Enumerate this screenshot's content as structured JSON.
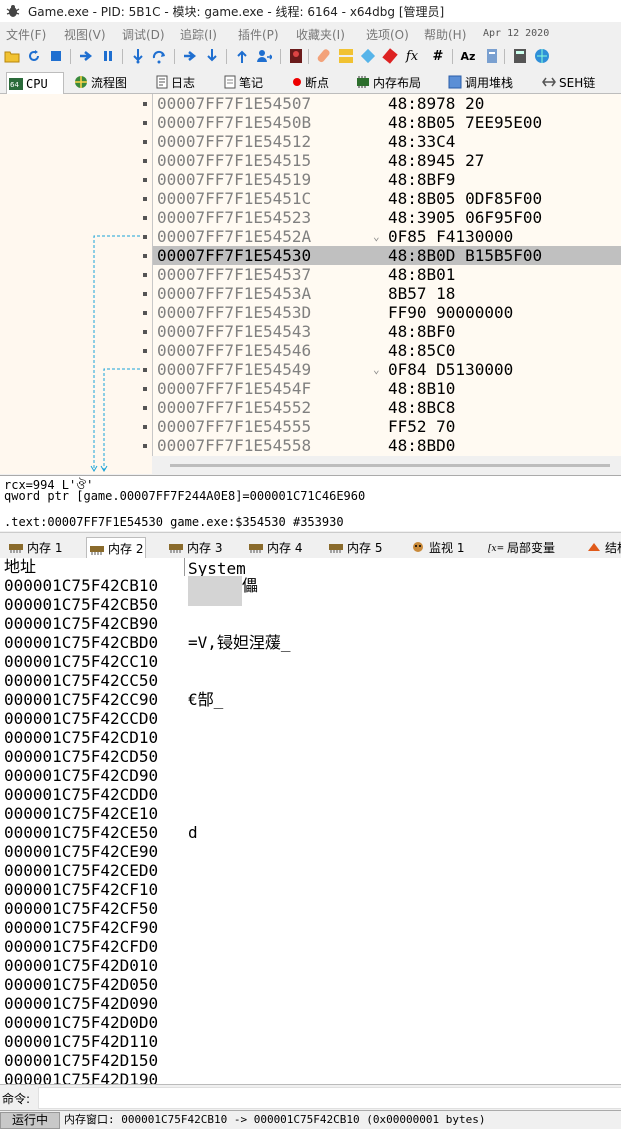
{
  "title": "Game.exe - PID: 5B1C - 模块: game.exe - 线程: 6164 - x64dbg [管理员]",
  "menu": [
    "文件(F)",
    "视图(V)",
    "调试(D)",
    "追踪(I)",
    "插件(P)",
    "收藏夹(I)",
    "选项(O)",
    "帮助(H)"
  ],
  "date": "Apr 12 2020",
  "toolbar_icons": [
    "open-icon",
    "restart-icon",
    "stop-icon",
    "run-icon",
    "pause-icon",
    "step-into-icon",
    "step-over-icon",
    "trace-into-icon",
    "trace-over-icon",
    "execute-till-return-icon",
    "run-to-user-code-icon",
    "scylla-icon",
    "patch-icon",
    "comment-icon",
    "label-icon",
    "bookmark-icon",
    "function-icon",
    "hash-icon",
    "font-icon",
    "settings-icon",
    "calculator-icon",
    "help-icon"
  ],
  "tabs": [
    {
      "label": "CPU",
      "icon": "cpu-icon"
    },
    {
      "label": "流程图",
      "icon": "graph-icon"
    },
    {
      "label": "日志",
      "icon": "log-icon"
    },
    {
      "label": "笔记",
      "icon": "notes-icon"
    },
    {
      "label": "断点",
      "icon": "breakpoint-icon"
    },
    {
      "label": "内存布局",
      "icon": "memory-map-icon"
    },
    {
      "label": "调用堆栈",
      "icon": "call-stack-icon"
    },
    {
      "label": "SEH链",
      "icon": "seh-icon"
    }
  ],
  "disasm": [
    {
      "addr": "00007FF7F1E54507",
      "bytes": "48:8978 20",
      "arrow": ""
    },
    {
      "addr": "00007FF7F1E5450B",
      "bytes": "48:8B05 7EE95E00",
      "arrow": ""
    },
    {
      "addr": "00007FF7F1E54512",
      "bytes": "48:33C4",
      "arrow": ""
    },
    {
      "addr": "00007FF7F1E54515",
      "bytes": "48:8945 27",
      "arrow": ""
    },
    {
      "addr": "00007FF7F1E54519",
      "bytes": "48:8BF9",
      "arrow": ""
    },
    {
      "addr": "00007FF7F1E5451C",
      "bytes": "48:8B05 0DF85F00",
      "arrow": ""
    },
    {
      "addr": "00007FF7F1E54523",
      "bytes": "48:3905 06F95F00",
      "arrow": ""
    },
    {
      "addr": "00007FF7F1E5452A",
      "bytes": "0F85 F4130000",
      "arrow": "⌄"
    },
    {
      "addr": "00007FF7F1E54530",
      "bytes": "48:8B0D B15B5F00",
      "arrow": ""
    },
    {
      "addr": "00007FF7F1E54537",
      "bytes": "48:8B01",
      "arrow": ""
    },
    {
      "addr": "00007FF7F1E5453A",
      "bytes": "8B57 18",
      "arrow": ""
    },
    {
      "addr": "00007FF7F1E5453D",
      "bytes": "FF90 90000000",
      "arrow": ""
    },
    {
      "addr": "00007FF7F1E54543",
      "bytes": "48:8BF0",
      "arrow": ""
    },
    {
      "addr": "00007FF7F1E54546",
      "bytes": "48:85C0",
      "arrow": ""
    },
    {
      "addr": "00007FF7F1E54549",
      "bytes": "0F84 D5130000",
      "arrow": "⌄"
    },
    {
      "addr": "00007FF7F1E5454F",
      "bytes": "48:8B10",
      "arrow": ""
    },
    {
      "addr": "00007FF7F1E54552",
      "bytes": "48:8BC8",
      "arrow": ""
    },
    {
      "addr": "00007FF7F1E54555",
      "bytes": "FF52 70",
      "arrow": ""
    },
    {
      "addr": "00007FF7F1E54558",
      "bytes": "48:8BD0",
      "arrow": ""
    }
  ],
  "selected_row": 8,
  "info": {
    "line1": "rcx=994 L'ঔ'",
    "line2": "qword ptr [game.00007FF7F244A0E8]=000001C71C46E960",
    "line3": ".text:00007FF7F1E54530 game.exe:$354530 #353930"
  },
  "mem_tabs": [
    {
      "label": "内存 1",
      "icon": "memory-icon"
    },
    {
      "label": "内存 2",
      "icon": "memory-icon"
    },
    {
      "label": "内存 3",
      "icon": "memory-icon"
    },
    {
      "label": "内存 4",
      "icon": "memory-icon"
    },
    {
      "label": "内存 5",
      "icon": "memory-icon"
    },
    {
      "label": "监视 1",
      "icon": "watch-icon"
    },
    {
      "label": "局部变量",
      "icon": "locals-icon"
    },
    {
      "label": "结构",
      "icon": "struct-icon"
    }
  ],
  "mem_active": 1,
  "mem_header": {
    "address": "地址",
    "text": "System"
  },
  "mem_rows": [
    {
      "addr": "000001C75F42CB10",
      "text": "儡"
    },
    {
      "addr": "000001C75F42CB50",
      "text": ""
    },
    {
      "addr": "000001C75F42CB90",
      "text": ""
    },
    {
      "addr": "000001C75F42CBD0",
      "text": "=V,锓妲涅蕿_"
    },
    {
      "addr": "000001C75F42CC10",
      "text": ""
    },
    {
      "addr": "000001C75F42CC50",
      "text": ""
    },
    {
      "addr": "000001C75F42CC90",
      "text": "€郜_"
    },
    {
      "addr": "000001C75F42CCD0",
      "text": ""
    },
    {
      "addr": "000001C75F42CD10",
      "text": ""
    },
    {
      "addr": "000001C75F42CD50",
      "text": ""
    },
    {
      "addr": "000001C75F42CD90",
      "text": ""
    },
    {
      "addr": "000001C75F42CDD0",
      "text": ""
    },
    {
      "addr": "000001C75F42CE10",
      "text": ""
    },
    {
      "addr": "000001C75F42CE50",
      "text": "d"
    },
    {
      "addr": "000001C75F42CE90",
      "text": ""
    },
    {
      "addr": "000001C75F42CED0",
      "text": ""
    },
    {
      "addr": "000001C75F42CF10",
      "text": ""
    },
    {
      "addr": "000001C75F42CF50",
      "text": ""
    },
    {
      "addr": "000001C75F42CF90",
      "text": ""
    },
    {
      "addr": "000001C75F42CFD0",
      "text": ""
    },
    {
      "addr": "000001C75F42D010",
      "text": ""
    },
    {
      "addr": "000001C75F42D050",
      "text": ""
    },
    {
      "addr": "000001C75F42D090",
      "text": ""
    },
    {
      "addr": "000001C75F42D0D0",
      "text": ""
    },
    {
      "addr": "000001C75F42D110",
      "text": ""
    },
    {
      "addr": "000001C75F42D150",
      "text": ""
    },
    {
      "addr": "000001C75F42D190",
      "text": ""
    }
  ],
  "command": {
    "label": "命令:",
    "value": ""
  },
  "status": {
    "state": "运行中",
    "message": "内存窗口: 000001C75F42CB10 -> 000001C75F42CB10 (0x00000001 bytes)"
  }
}
